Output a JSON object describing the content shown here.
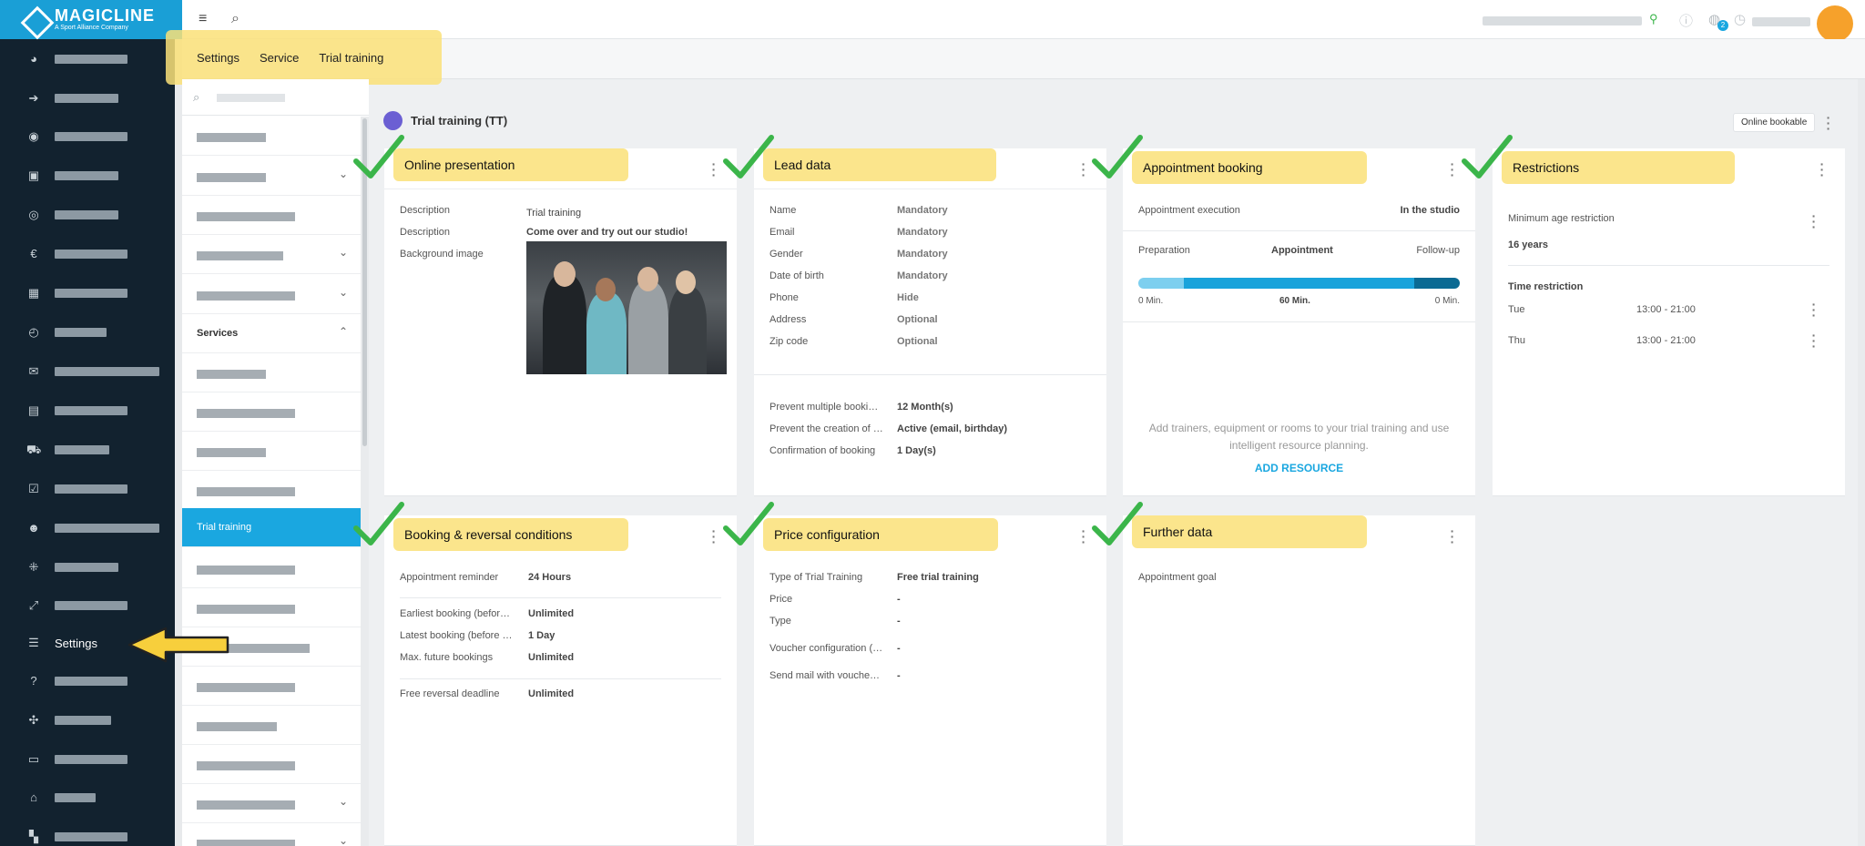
{
  "brand": {
    "name": "MAGICLINE",
    "tagline": "A Sport Alliance Company"
  },
  "nav": {
    "settings_label": "Settings"
  },
  "topbar": {
    "notification_count": "2"
  },
  "breadcrumb": [
    "Settings",
    "Service",
    "Trial training"
  ],
  "subnav": {
    "section_label": "Services",
    "active_label": "Trial training"
  },
  "page": {
    "title": "Trial training (TT)",
    "online_bookable": "Online bookable"
  },
  "cards": {
    "online_presentation": {
      "title": "Online presentation",
      "rows": [
        {
          "label": "Description",
          "value": "Trial training"
        },
        {
          "label": "Description",
          "value": "Come over and try out our studio!"
        },
        {
          "label": "Background image",
          "value": ""
        }
      ]
    },
    "lead_data": {
      "title": "Lead data",
      "rows": [
        {
          "label": "Name",
          "value": "Mandatory"
        },
        {
          "label": "Email",
          "value": "Mandatory"
        },
        {
          "label": "Gender",
          "value": "Mandatory"
        },
        {
          "label": "Date of birth",
          "value": "Mandatory"
        },
        {
          "label": "Phone",
          "value": "Hide"
        },
        {
          "label": "Address",
          "value": "Optional"
        },
        {
          "label": "Zip code",
          "value": "Optional"
        }
      ],
      "rows2": [
        {
          "label": "Prevent multiple booki…",
          "value": "12 Month(s)"
        },
        {
          "label": "Prevent the creation of …",
          "value": "Active (email, birthday)"
        },
        {
          "label": "Confirmation of booking",
          "value": "1 Day(s)"
        }
      ]
    },
    "appointment_booking": {
      "title": "Appointment booking",
      "execution_label": "Appointment execution",
      "execution_value": "In the studio",
      "phase_labels": [
        "Preparation",
        "Appointment",
        "Follow-up"
      ],
      "phase_values": [
        "0 Min.",
        "60 Min.",
        "0 Min."
      ],
      "phase_minutes": [
        0,
        60,
        0
      ],
      "hint": "Add trainers, equipment or rooms to your trial training and use intelligent resource planning.",
      "add_resource": "ADD RESOURCE"
    },
    "restrictions": {
      "title": "Restrictions",
      "min_age_label": "Minimum age restriction",
      "min_age_value": "16 years",
      "time_label": "Time restriction",
      "times": [
        {
          "day": "Tue",
          "range": "13:00 - 21:00"
        },
        {
          "day": "Thu",
          "range": "13:00 - 21:00"
        }
      ]
    },
    "booking_reversal": {
      "title": "Booking & reversal conditions",
      "rows": [
        {
          "label": "Appointment reminder",
          "value": "24 Hours"
        },
        {
          "label": "Earliest booking (befor…",
          "value": "Unlimited"
        },
        {
          "label": "Latest booking (before …",
          "value": "1 Day"
        },
        {
          "label": "Max. future bookings",
          "value": "Unlimited"
        },
        {
          "label": "Free reversal deadline",
          "value": "Unlimited"
        }
      ]
    },
    "price_configuration": {
      "title": "Price configuration",
      "rows": [
        {
          "label": "Type of Trial Training",
          "value": "Free trial training"
        },
        {
          "label": "Price",
          "value": "-"
        },
        {
          "label": "Type",
          "value": "-"
        },
        {
          "label": "Voucher configuration (…",
          "value": "-"
        },
        {
          "label": "Send mail with vouche…",
          "value": "-"
        }
      ]
    },
    "further_data": {
      "title": "Further data",
      "goal_label": "Appointment goal"
    }
  },
  "colors": {
    "nav_bg": "#12222f",
    "brand_blue": "#1a9fd6",
    "active_blue": "#1aa7e0",
    "highlight_yellow": "#fae078",
    "check_green": "#3bb54a",
    "arrow_yellow": "#f7cf3c",
    "avatar_orange": "#f6a12b",
    "bar_prep": "#7dcfef",
    "bar_appt": "#19a3db",
    "bar_follow": "#0b6a93"
  },
  "icons": [
    "menu-icon",
    "search-icon",
    "location-icon",
    "help-icon",
    "notification-icon",
    "clock-icon",
    "kebab-icon",
    "chevron-down-icon",
    "chevron-up-icon",
    "check-icon",
    "arrow-icon"
  ]
}
